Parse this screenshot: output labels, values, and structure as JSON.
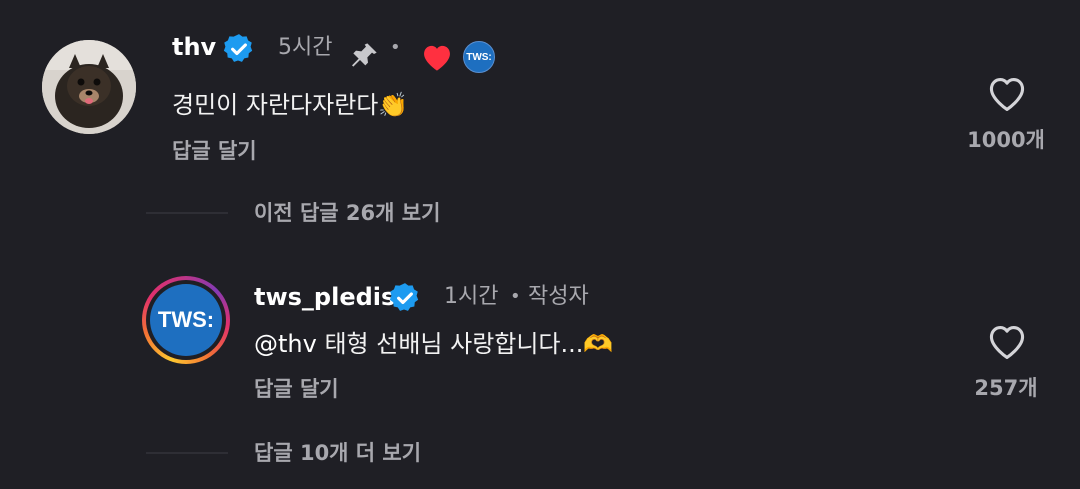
{
  "comment1": {
    "username": "thv",
    "time": "5시간",
    "dot": "•",
    "badge_text": "TWS:",
    "text": "경민이 자란다자란다",
    "emoji": "👏",
    "reply_label": "답글 달기",
    "likes": "1000개",
    "previous_replies": "이전 답글 26개 보기"
  },
  "comment2": {
    "username": "tws_pledis",
    "time": "1시간",
    "dot": "•",
    "author_tag": "작성자",
    "avatar_text": "TWS:",
    "mention": "@thv",
    "text": " 태형 선배님 사랑합니다...",
    "emoji": "🫶",
    "reply_label": "답글 달기",
    "likes": "257개",
    "more_replies": "답글 10개 더 보기"
  },
  "colors": {
    "background": "#1f1f25",
    "verified": "#1d9bf0",
    "heart_red": "#ff3040",
    "tws_blue": "#1e6fc0"
  }
}
